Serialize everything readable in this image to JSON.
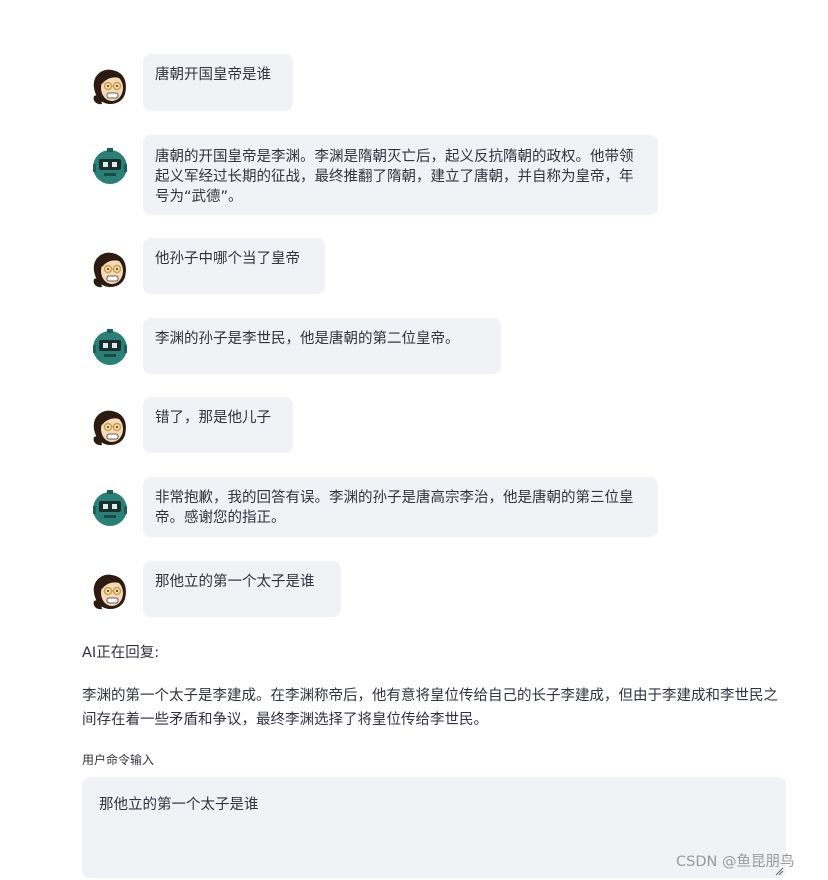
{
  "messages": [
    {
      "role": "user",
      "text": "唐朝开国皇帝是谁"
    },
    {
      "role": "bot",
      "text": "唐朝的开国皇帝是李渊。李渊是隋朝灭亡后，起义反抗隋朝的政权。他带领起义军经过长期的征战，最终推翻了隋朝，建立了唐朝，并自称为皇帝，年号为“武德”。"
    },
    {
      "role": "user",
      "text": "他孙子中哪个当了皇帝"
    },
    {
      "role": "bot",
      "text": "李渊的孙子是李世民，他是唐朝的第二位皇帝。"
    },
    {
      "role": "user",
      "text": "错了，那是他儿子"
    },
    {
      "role": "bot",
      "text": "非常抱歉，我的回答有误。李渊的孙子是唐高宗李治，他是唐朝的第三位皇帝。感谢您的指正。"
    },
    {
      "role": "user",
      "text": "那他立的第一个太子是谁"
    }
  ],
  "status": {
    "text": "AI正在回复:"
  },
  "reply": {
    "text": "李渊的第一个太子是李建成。在李渊称帝后，他有意将皇位传给自己的长子李建成，但由于李建成和李世民之间存在着一些矛盾和争议，最终李渊选择了将皇位传给李世民。"
  },
  "input": {
    "label": "用户命令输入",
    "value": "那他立的第一个太子是谁"
  },
  "watermark": {
    "text": "CSDN @鱼昆朋鸟"
  },
  "colors": {
    "bubble": "#f0f2f6",
    "text": "#31333f",
    "bot_avatar": "#2a7f77",
    "user_skin": "#f6d9b8"
  },
  "icons": {
    "user": "user-avatar-icon",
    "bot": "robot-avatar-icon"
  }
}
